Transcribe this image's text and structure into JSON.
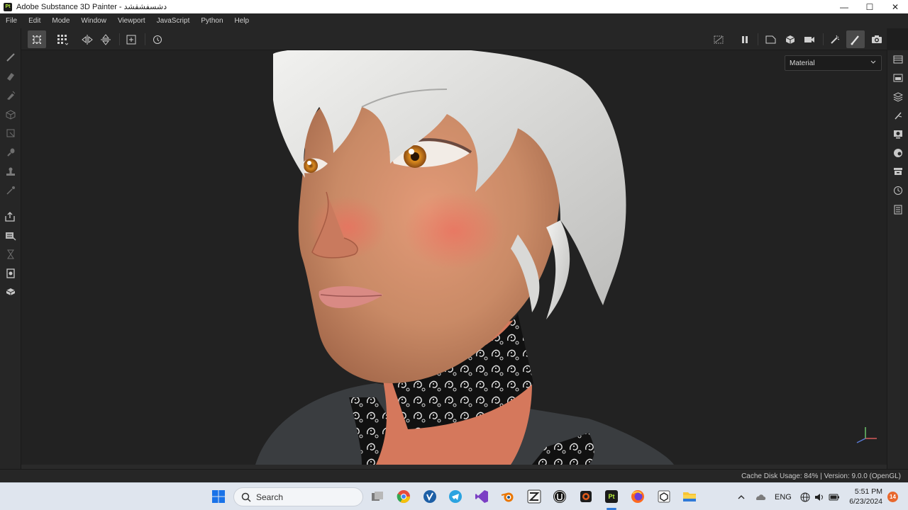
{
  "window": {
    "app_logo": "Pt",
    "title": "Adobe Substance 3D Painter - دشسفشقشد",
    "controls": [
      "—",
      "☐",
      "✕"
    ]
  },
  "menu": [
    "File",
    "Edit",
    "Mode",
    "Window",
    "Viewport",
    "JavaScript",
    "Python",
    "Help"
  ],
  "toolbar": {
    "left_icons": [
      "grid-snap-icon",
      "grid-options-icon",
      "symmetry-x-icon",
      "symmetry-y-icon",
      "add-frame-icon",
      "history-reset-icon"
    ],
    "right_icons": [
      "hide-icon",
      "pause-icon",
      "camera-persp-icon",
      "cube-view-icon",
      "video-camera-icon",
      "brush-lighting-icon",
      "paint-brush-icon",
      "screenshot-icon"
    ],
    "active_tool": "paint-brush-icon"
  },
  "left_tools": [
    "paint-icon",
    "eraser-icon",
    "projection-icon",
    "geometry-fill-icon",
    "polygon-fill-icon",
    "smudge-icon",
    "clone-icon",
    "color-picker-icon",
    "export-icon",
    "bake-icon",
    "hourglass-icon",
    "texture-set-icon",
    "mesh-icon"
  ],
  "right_tools": [
    "layers-panel-icon",
    "properties-panel-icon",
    "stack-icon",
    "brush-settings-icon",
    "display-settings-icon",
    "shader-icon",
    "assets-icon",
    "history-icon",
    "log-icon"
  ],
  "viewport": {
    "mode_select": "Material",
    "background": "#222222"
  },
  "status": {
    "text": "Cache Disk Usage:  84% | Version: 9.0.0 (OpenGL)"
  },
  "taskbar": {
    "search_placeholder": "Search",
    "apps": [
      "start-icon",
      "task-view-icon",
      "chrome-icon",
      "vscode-like-icon",
      "telegram-icon",
      "visual-studio-icon",
      "blender-icon",
      "zbrush-icon",
      "unreal-icon",
      "substance-designer-icon",
      "substance-painter-icon",
      "firefox-icon",
      "unity-icon",
      "file-explorer-icon"
    ],
    "active_app_label": "Pt",
    "tray_lang": "ENG",
    "time": "5:51 PM",
    "date": "6/23/2024",
    "notification_count": "14"
  }
}
